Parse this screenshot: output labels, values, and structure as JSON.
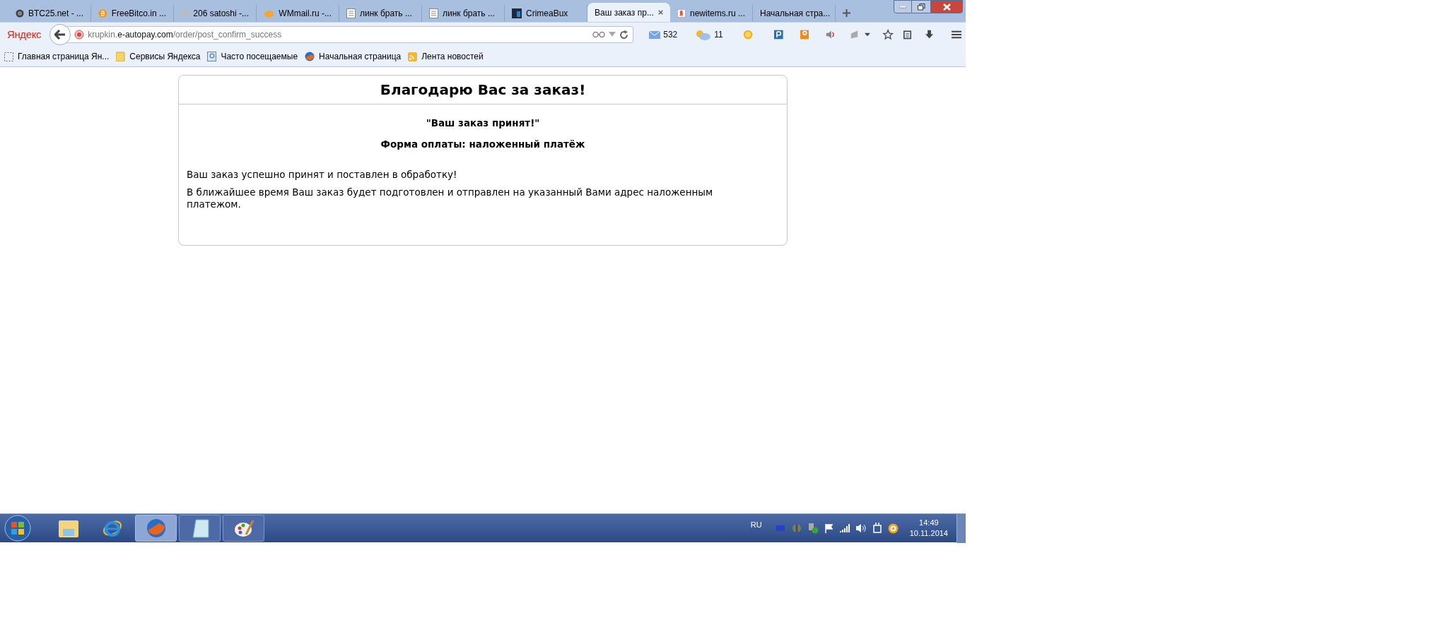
{
  "tabs": [
    {
      "title": "BTC25.net - ...",
      "selected": false
    },
    {
      "title": "FreeBitco.in ...",
      "selected": false
    },
    {
      "title": "206 satoshi -...",
      "selected": false
    },
    {
      "title": "WMmail.ru -...",
      "selected": false
    },
    {
      "title": "линк брать ...",
      "selected": false
    },
    {
      "title": "линк брать ...",
      "selected": false
    },
    {
      "title": "CrimeaBux",
      "selected": false
    },
    {
      "title": "Ваш заказ пр...",
      "selected": true
    },
    {
      "title": "newitems.ru ...",
      "selected": false
    },
    {
      "title": "Начальная стра...",
      "selected": false
    }
  ],
  "toolbar": {
    "logo": "Яндекс",
    "url": {
      "subdomain": "krupkin.",
      "domain": "e-autopay.com",
      "path": "/order/post_confirm_success"
    },
    "mail_count": "532",
    "temperature": "11"
  },
  "bookmarks": [
    "Главная страница Ян...",
    "Сервисы Яндекса",
    "Часто посещаемые",
    "Начальная страница",
    "Лента новостей"
  ],
  "page": {
    "heading": "Благодарю Вас за заказ!",
    "status": "\"Ваш заказ принят!\"",
    "payment": "Форма оплаты: наложенный платёж",
    "paragraphs": [
      "Ваш заказ успешно принят и поставлен в обработку!",
      "В ближайшее время Ваш заказ будет подготовлен и отправлен на указанный Вами адрес наложенным платежом."
    ]
  },
  "taskbar": {
    "apps": [
      {
        "selected": false
      },
      {
        "selected": false
      },
      {
        "selected": true
      },
      {
        "selected": false
      },
      {
        "selected": false
      }
    ],
    "language": "RU",
    "time": "14:49",
    "date": "10.11.2014"
  }
}
